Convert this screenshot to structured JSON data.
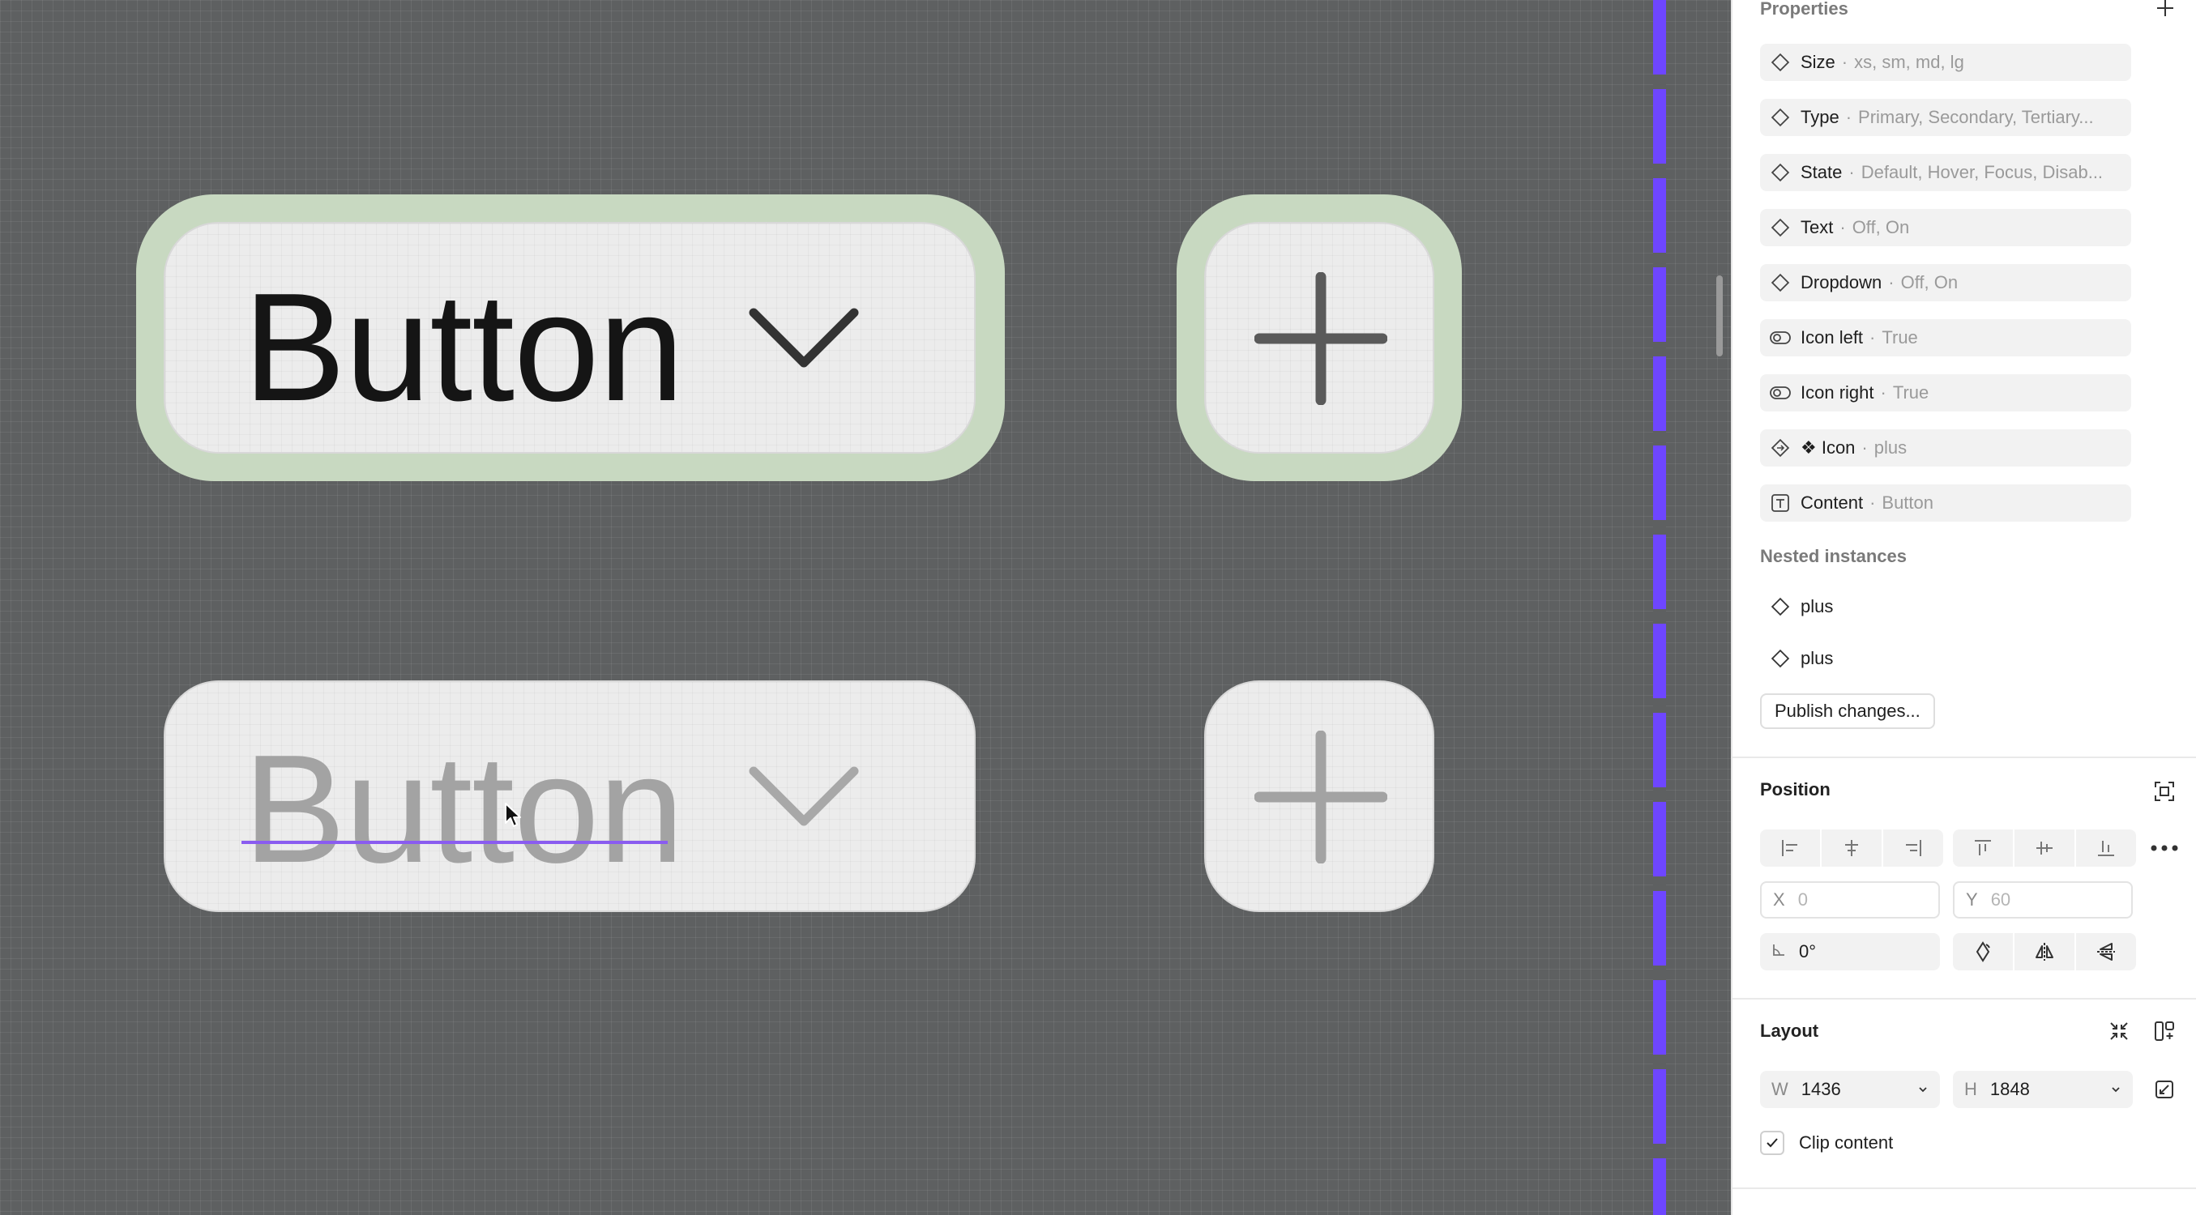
{
  "canvas": {
    "button_dropdown_label": "Button",
    "button_dropdown_label_editing": "Button",
    "colors": {
      "focus_ring": "#c8d9c1",
      "frame_edge": "#6e46ff",
      "surface": "#ececec"
    }
  },
  "panel": {
    "properties": {
      "title": "Properties",
      "add_icon": "plus-icon",
      "items": [
        {
          "icon": "variant-diamond-icon",
          "name": "Size",
          "sep": "·",
          "value": "xs, sm, md, lg"
        },
        {
          "icon": "variant-diamond-icon",
          "name": "Type",
          "sep": "·",
          "value": "Primary, Secondary, Tertiary..."
        },
        {
          "icon": "variant-diamond-icon",
          "name": "State",
          "sep": "·",
          "value": "Default, Hover, Focus, Disab..."
        },
        {
          "icon": "variant-diamond-icon",
          "name": "Text",
          "sep": "·",
          "value": "Off, On"
        },
        {
          "icon": "variant-diamond-icon",
          "name": "Dropdown",
          "sep": "·",
          "value": "Off, On"
        },
        {
          "icon": "boolean-toggle-icon",
          "name": "Icon left",
          "sep": "·",
          "value": "True"
        },
        {
          "icon": "boolean-toggle-icon",
          "name": "Icon right",
          "sep": "·",
          "value": "True"
        },
        {
          "icon": "instance-swap-icon",
          "name": "❖ Icon",
          "sep": "·",
          "value": "plus"
        },
        {
          "icon": "text-property-icon",
          "name": "Content",
          "sep": "·",
          "value": "Button"
        }
      ]
    },
    "nested": {
      "title": "Nested instances",
      "items": [
        {
          "icon": "instance-diamond-icon",
          "name": "plus"
        },
        {
          "icon": "instance-diamond-icon",
          "name": "plus"
        }
      ],
      "publish_label": "Publish changes..."
    },
    "position": {
      "title": "Position",
      "x_label": "X",
      "x_value": "0",
      "y_label": "Y",
      "y_value": "60",
      "rotation_value": "0°"
    },
    "layout": {
      "title": "Layout",
      "w_label": "W",
      "w_value": "1436",
      "h_label": "H",
      "h_value": "1848",
      "clip_label": "Clip content",
      "clip_checked": true
    }
  }
}
